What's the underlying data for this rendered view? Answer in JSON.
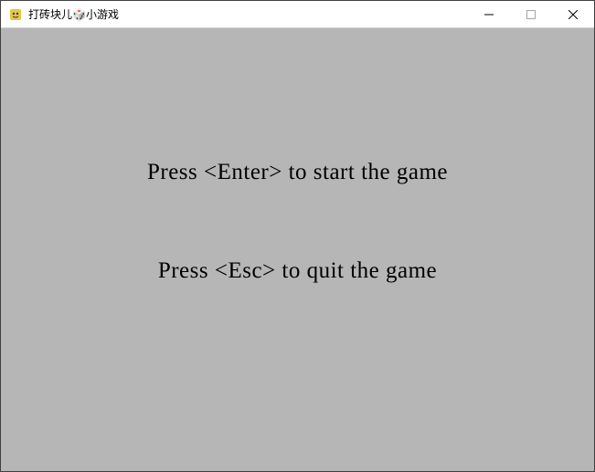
{
  "window": {
    "title": "打砖块儿🎲小游戏"
  },
  "content": {
    "start_message": "Press <Enter> to start the game",
    "quit_message": "Press <Esc> to quit the game"
  }
}
